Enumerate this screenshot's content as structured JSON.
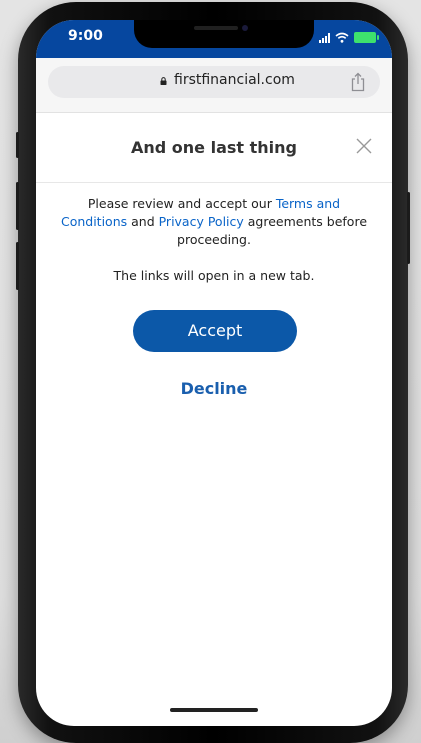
{
  "status_bar": {
    "time": "9:00",
    "accent": "#06479f",
    "icons": [
      "signal-icon",
      "wifi-icon",
      "battery-icon"
    ]
  },
  "browser": {
    "url": "firstfinancial.com",
    "lock_icon": "lock-icon",
    "share_icon": "share-icon"
  },
  "modal": {
    "title": "And one last thing",
    "close_icon": "close-icon",
    "body_prefix": "Please review and accept our ",
    "terms_link": "Terms and Conditions",
    "and_text": " and ",
    "privacy_link": "Privacy Policy",
    "body_suffix": " agreements before proceeding.",
    "note": "The links will open in a new tab.",
    "accept_label": "Accept",
    "decline_label": "Decline",
    "link_color": "#0a64c8",
    "button_color": "#0c58a8"
  }
}
